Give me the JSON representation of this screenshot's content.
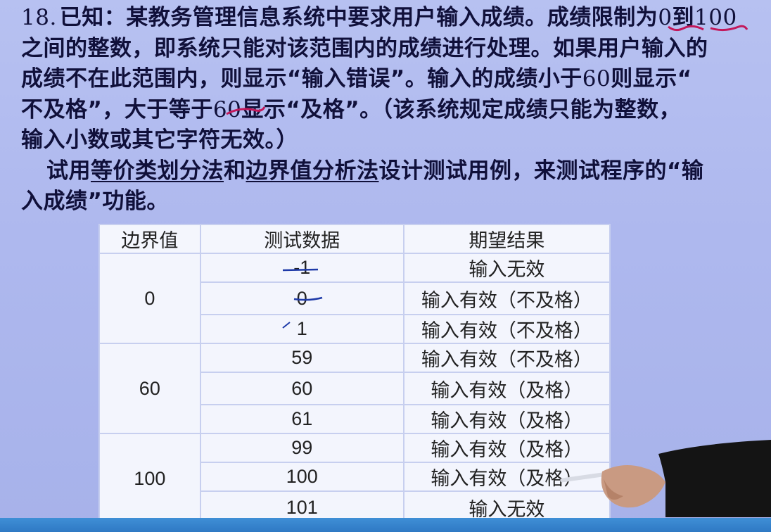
{
  "problem": {
    "number": "18.",
    "line1_a": "已知：某教务管理信息系统中要求用户输入成绩。成绩限制为",
    "line1_b": "0",
    "line1_c": "到",
    "line1_d": "100",
    "line2": "之间的整数，即系统只能对该范围内的成绩进行处理。如果用户输入的",
    "line3_a": "成绩不在此范围内，则显示“输入错误”。输入的成绩小于",
    "line3_b": "60",
    "line3_c": "则显示“",
    "line4_a": "不及格”，大于等于",
    "line4_b": "60",
    "line4_c": "显示“及格”。（该系统规定成绩只能为整数，",
    "line5": "输入小数或其它字符无效。）",
    "line6_a": "试用",
    "line6_b": "等价类划分法",
    "line6_c": "和",
    "line6_d": "边界值分析法",
    "line6_e": "设计测试用例，来测试程序的“输",
    "line7": "入成绩”功能。"
  },
  "table": {
    "headers": [
      "边界值",
      "测试数据",
      "期望结果"
    ],
    "groups": [
      {
        "boundary": "0",
        "rows": [
          {
            "data": "-1",
            "result": "输入无效"
          },
          {
            "data": "0",
            "result": "输入有效（不及格）"
          },
          {
            "data": "1",
            "result": "输入有效（不及格）"
          }
        ]
      },
      {
        "boundary": "60",
        "rows": [
          {
            "data": "59",
            "result": "输入有效（不及格）"
          },
          {
            "data": "60",
            "result": "输入有效（及格）"
          },
          {
            "data": "61",
            "result": "输入有效（及格）"
          }
        ]
      },
      {
        "boundary": "100",
        "rows": [
          {
            "data": "99",
            "result": "输入有效（及格）"
          },
          {
            "data": "100",
            "result": "输入有效（及格）"
          },
          {
            "data": "101",
            "result": "输入无效"
          }
        ]
      }
    ]
  },
  "colors": {
    "background": "#b7c1f1",
    "text": "#10103a",
    "annotation_red": "#c2185b",
    "annotation_blue": "#1e3aa8",
    "bottom_bar": "#2f79c4"
  }
}
